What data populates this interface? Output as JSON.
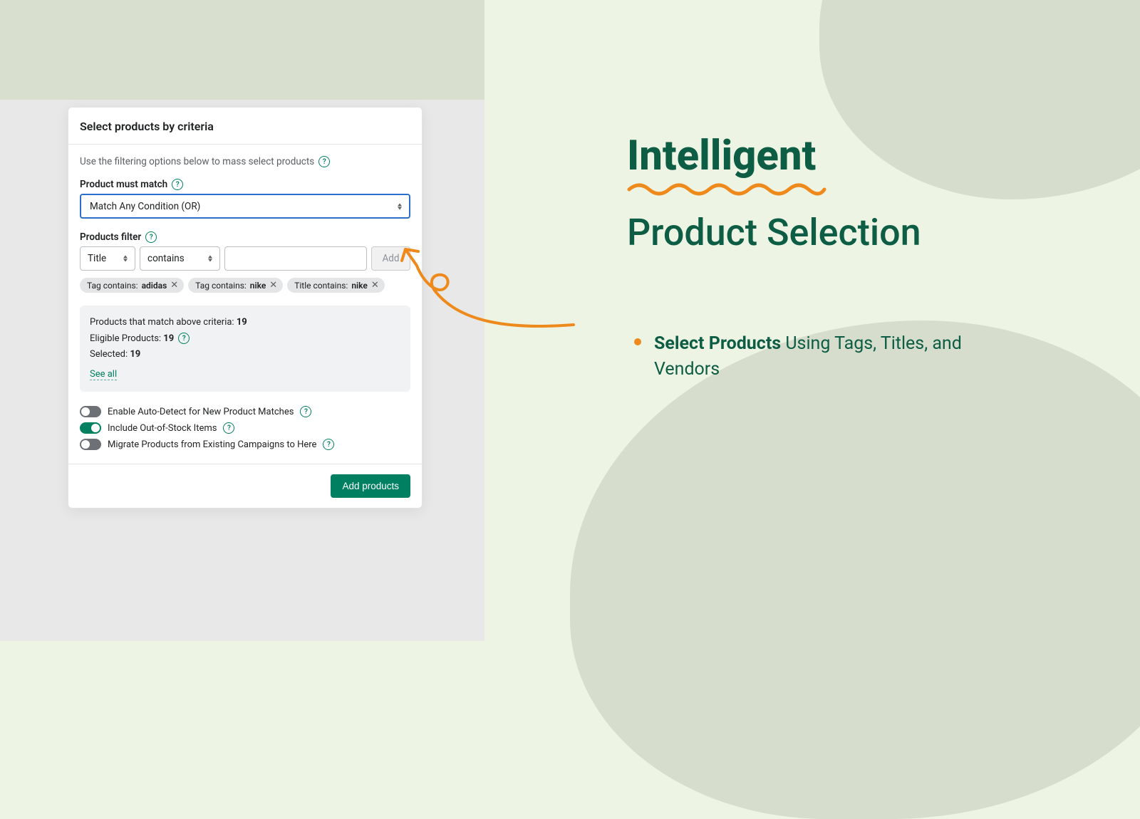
{
  "panel": {
    "title": "Select products by criteria",
    "intro": "Use the filtering options below to mass select products",
    "match_label": "Product must match",
    "match_value": "Match Any Condition (OR)",
    "filter_label": "Products filter",
    "filter_field": "Title",
    "filter_op": "contains",
    "add_label": "Add",
    "chips": [
      {
        "prefix": "Tag contains: ",
        "value": "adidas"
      },
      {
        "prefix": "Tag contains: ",
        "value": "nike"
      },
      {
        "prefix": "Title contains: ",
        "value": "nike"
      }
    ],
    "stats": {
      "match_label": "Products that match above criteria: ",
      "match_count": "19",
      "eligible_label": "Eligible Products: ",
      "eligible_count": "19",
      "selected_label": "Selected: ",
      "selected_count": "19",
      "see_all": "See all"
    },
    "toggles": [
      {
        "on": false,
        "label": "Enable Auto-Detect for New Product Matches"
      },
      {
        "on": true,
        "label": "Include Out-of-Stock Items"
      },
      {
        "on": false,
        "label": "Migrate Products from Existing Campaigns to Here"
      }
    ],
    "submit": "Add products"
  },
  "marketing": {
    "h1a": "Intelligent",
    "h1b": "Product Selection",
    "bullet_bold": "Select Products",
    "bullet_rest": " Using Tags, Titles, and Vendors"
  },
  "colors": {
    "brand": "#008060",
    "deep": "#0d5c44",
    "accent": "#ee8a1c"
  }
}
